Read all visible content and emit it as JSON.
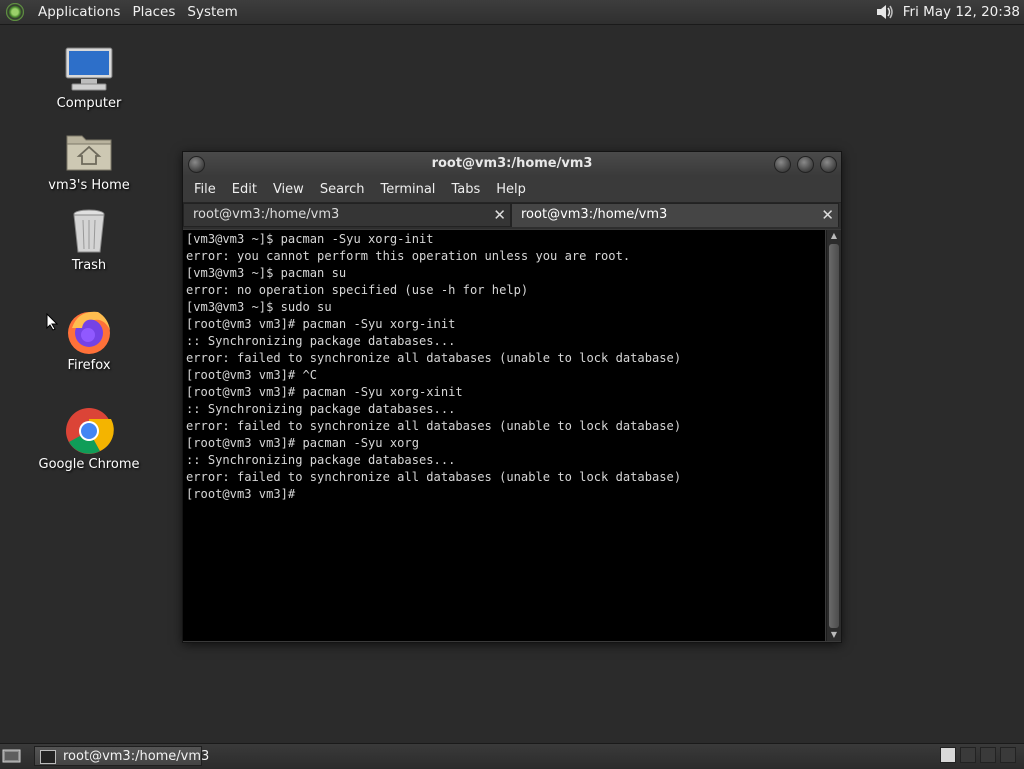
{
  "top_panel": {
    "menus": [
      "Applications",
      "Places",
      "System"
    ],
    "clock": "Fri May 12, 20:38",
    "icons": [
      "distro-logo-icon",
      "volume-icon"
    ]
  },
  "desktop": {
    "icons": [
      {
        "label": "Computer",
        "icon": "computer-icon"
      },
      {
        "label": "vm3's Home",
        "icon": "home-folder-icon"
      },
      {
        "label": "Trash",
        "icon": "trash-icon"
      },
      {
        "label": "Firefox",
        "icon": "firefox-icon"
      },
      {
        "label": "Google Chrome",
        "icon": "chrome-icon"
      }
    ]
  },
  "window": {
    "title": "root@vm3:/home/vm3",
    "menu": [
      "File",
      "Edit",
      "View",
      "Search",
      "Terminal",
      "Tabs",
      "Help"
    ],
    "tabs": [
      {
        "label": "root@vm3:/home/vm3",
        "active": false
      },
      {
        "label": "root@vm3:/home/vm3",
        "active": true
      }
    ],
    "terminal_text": "[vm3@vm3 ~]$ pacman -Syu xorg-init\nerror: you cannot perform this operation unless you are root.\n[vm3@vm3 ~]$ pacman su\nerror: no operation specified (use -h for help)\n[vm3@vm3 ~]$ sudo su\n[root@vm3 vm3]# pacman -Syu xorg-init\n:: Synchronizing package databases...\nerror: failed to synchronize all databases (unable to lock database)\n[root@vm3 vm3]# ^C\n[root@vm3 vm3]# pacman -Syu xorg-xinit\n:: Synchronizing package databases...\nerror: failed to synchronize all databases (unable to lock database)\n[root@vm3 vm3]# pacman -Syu xorg\n:: Synchronizing package databases...\nerror: failed to synchronize all databases (unable to lock database)\n[root@vm3 vm3]# "
  },
  "bottom_panel": {
    "task_label": "root@vm3:/home/vm3"
  },
  "colors": {
    "desktop_bg": "#2b2b2b",
    "terminal_bg": "#000000",
    "terminal_fg": "#d6d6d6"
  }
}
